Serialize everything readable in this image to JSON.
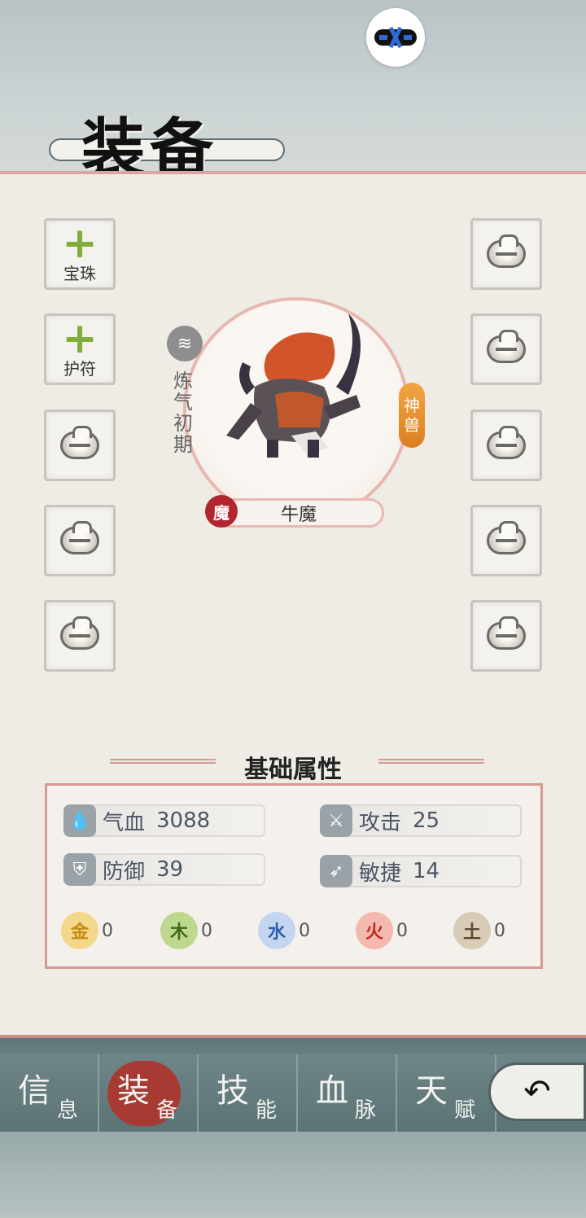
{
  "title": "装备",
  "left_slots": [
    {
      "type": "add",
      "label": "宝珠"
    },
    {
      "type": "add",
      "label": "护符"
    },
    {
      "type": "locked"
    },
    {
      "type": "locked"
    },
    {
      "type": "locked"
    }
  ],
  "right_slots": [
    {
      "type": "locked"
    },
    {
      "type": "locked"
    },
    {
      "type": "locked"
    },
    {
      "type": "locked"
    },
    {
      "type": "locked"
    }
  ],
  "character": {
    "realm": "炼气初期",
    "tag": "神兽",
    "seal": "魔",
    "name": "牛魔"
  },
  "stats_section_title": "基础属性",
  "stats": [
    {
      "icon": "blood-drop-icon",
      "name": "气血",
      "value": "3088"
    },
    {
      "icon": "attack-icon",
      "name": "攻击",
      "value": "25"
    },
    {
      "icon": "shield-icon",
      "name": "防御",
      "value": "39"
    },
    {
      "icon": "agility-icon",
      "name": "敏捷",
      "value": "14"
    }
  ],
  "elements": [
    {
      "glyph": "金",
      "value": "0",
      "color": "#e9b93a"
    },
    {
      "glyph": "木",
      "value": "0",
      "color": "#86b045"
    },
    {
      "glyph": "水",
      "value": "0",
      "color": "#7fa4d6"
    },
    {
      "glyph": "火",
      "value": "0",
      "color": "#e36f5e"
    },
    {
      "glyph": "土",
      "value": "0",
      "color": "#a08d72"
    }
  ],
  "nav": [
    {
      "big": "信",
      "small": "息",
      "active": false
    },
    {
      "big": "装",
      "small": "备",
      "active": true
    },
    {
      "big": "技",
      "small": "能",
      "active": false
    },
    {
      "big": "血",
      "small": "脉",
      "active": false
    },
    {
      "big": "天",
      "small": "赋",
      "active": false
    }
  ]
}
